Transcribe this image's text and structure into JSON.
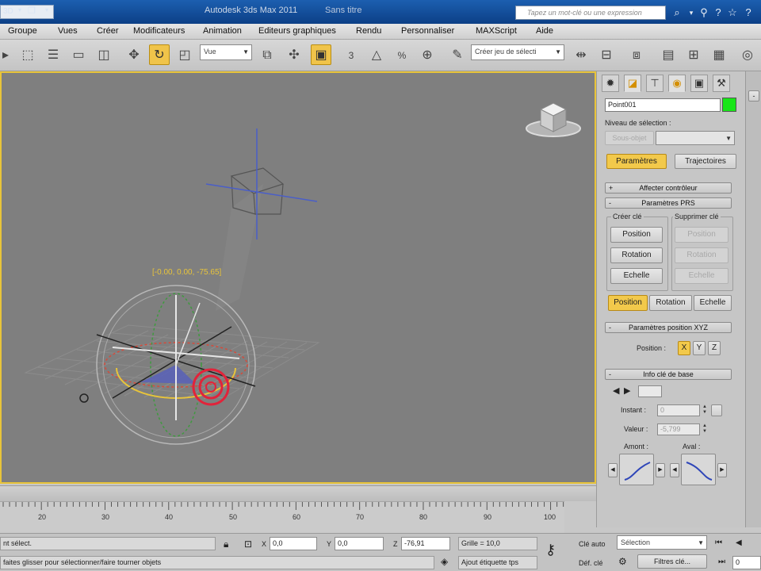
{
  "window": {
    "title": "Autodesk 3ds Max 2011",
    "subtitle": "Sans titre",
    "quick_access_label": "3D",
    "search_placeholder": "Tapez un mot-clé ou une expression"
  },
  "menu": [
    "Groupe",
    "Vues",
    "Créer",
    "Modificateurs",
    "Animation",
    "Editeurs graphiques",
    "Rendu",
    "Personnaliser",
    "MAXScript",
    "Aide"
  ],
  "toolbar": {
    "coord_system": "Vue",
    "selection_set_placeholder": "Créer jeu de sélecti",
    "snap_3": "3",
    "snap_percent": "%"
  },
  "viewport": {
    "coord_readout": "[-0.00, 0.00, -75.65]",
    "accent": "#e8c43a",
    "background": "#7f7f7f"
  },
  "command_panel": {
    "object_name": "Point001",
    "object_color": "#19e619",
    "selection_level_label": "Niveau de sélection :",
    "sub_object_label": "Sous-objet",
    "tab_parameters": "Paramètres",
    "tab_trajectories": "Trajectoires",
    "rollout_assign": "Affecter contrôleur",
    "rollout_prs": "Paramètres PRS",
    "create_key_label": "Créer clé",
    "delete_key_label": "Supprimer clé",
    "create_buttons": [
      "Position",
      "Rotation",
      "Echelle"
    ],
    "delete_buttons": [
      "Position",
      "Rotation",
      "Echelle"
    ],
    "mode_buttons": [
      "Position",
      "Rotation",
      "Echelle"
    ],
    "rollout_position_xyz": "Paramètres position XYZ",
    "position_label": "Position :",
    "axis_buttons": [
      "X",
      "Y",
      "Z"
    ],
    "rollout_key_info": "Info clé de base",
    "instant_label": "Instant :",
    "instant_value": "0",
    "value_label": "Valeur :",
    "value_value": "-5,799",
    "in_label": "Amont :",
    "out_label": "Aval :"
  },
  "timeline": {
    "ticks": [
      "20",
      "30",
      "40",
      "50",
      "60",
      "70",
      "80",
      "90",
      "100"
    ]
  },
  "status": {
    "selection_text": "nt sélect.",
    "prompt_text": "faites glisser pour sélectionner/faire tourner objets",
    "x_value": "0,0",
    "y_value": "0,0",
    "z_value": "-76,91",
    "x_label": "X",
    "y_label": "Y",
    "z_label": "Z",
    "grid_text": "Grille = 10,0",
    "time_tag_button": "Ajout étiquette tps",
    "auto_key_label": "Clé auto",
    "set_key_label": "Déf. clé",
    "key_mode_value": "Sélection",
    "key_filters_label": "Filtres clé...",
    "frame_value": "0"
  }
}
